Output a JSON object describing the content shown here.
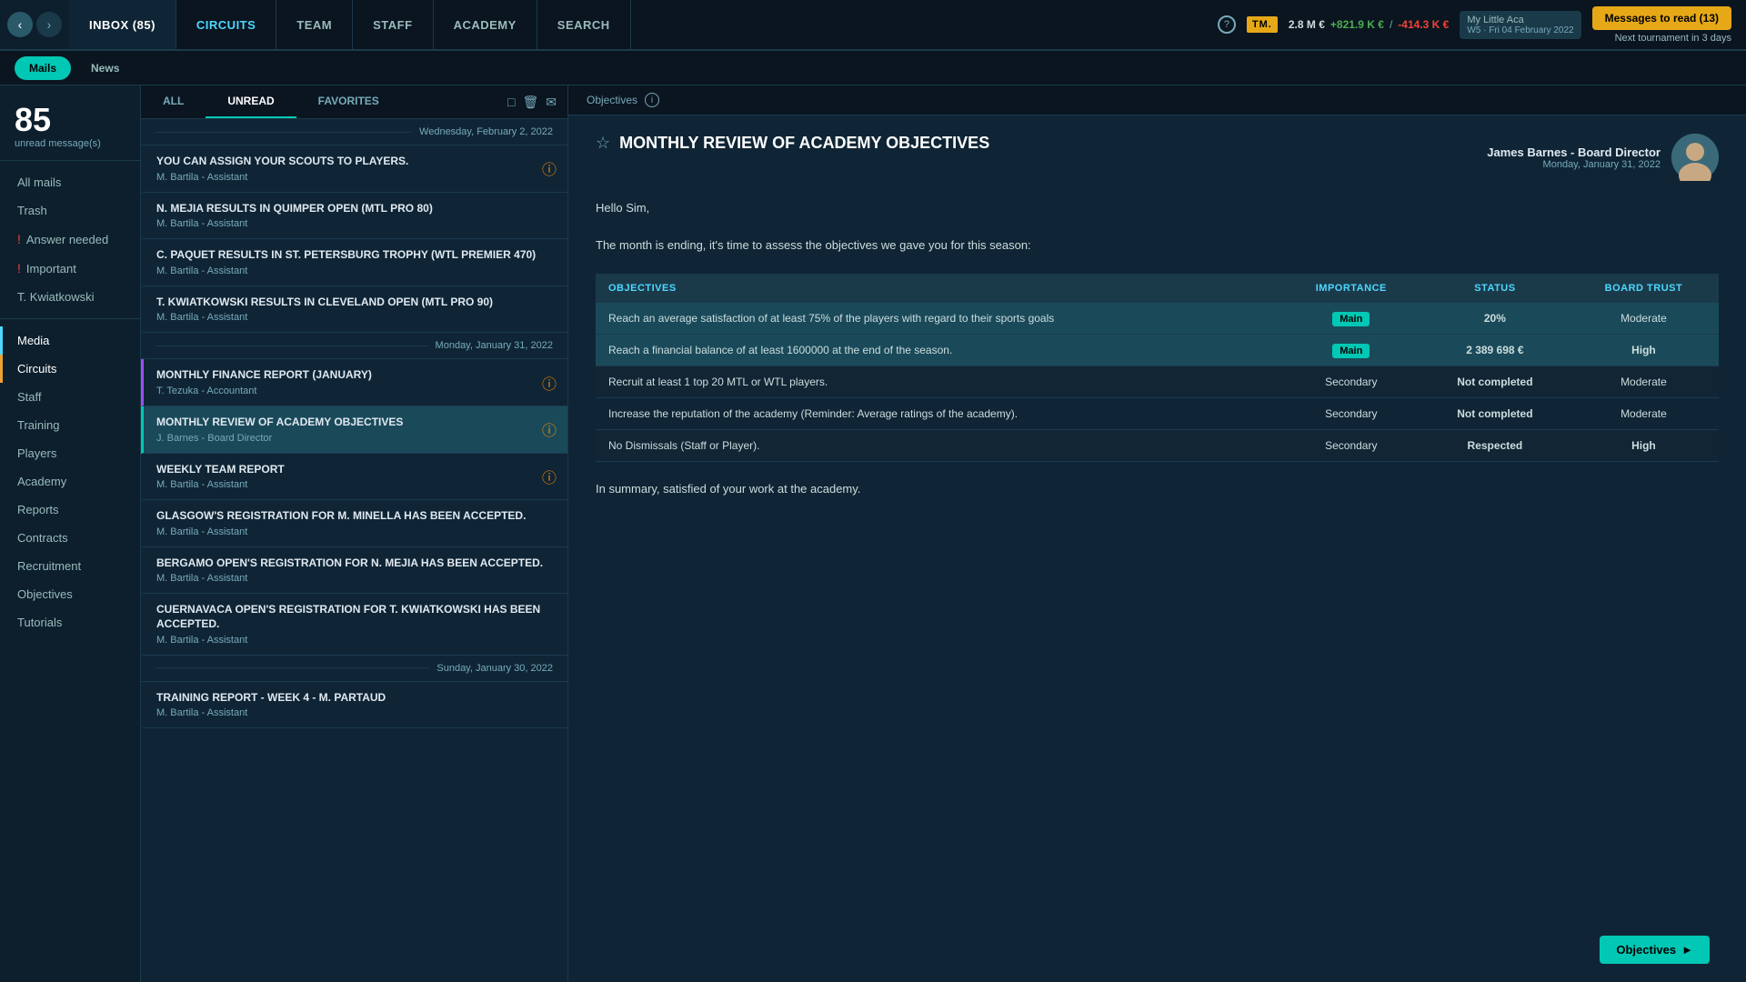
{
  "topnav": {
    "items": [
      {
        "id": "inbox",
        "label": "INBOX (85)",
        "active": true
      },
      {
        "id": "circuits",
        "label": "CIRCUITS",
        "active": false,
        "highlight": true
      },
      {
        "id": "team",
        "label": "TEAM",
        "active": false
      },
      {
        "id": "staff",
        "label": "STAFF",
        "active": false
      },
      {
        "id": "academy",
        "label": "ACADEMY",
        "active": false
      },
      {
        "id": "search",
        "label": "SEARCH",
        "active": false
      }
    ],
    "finance": {
      "balance": "2.8 M €",
      "income": "+821.9 K €",
      "expense": "-414.3 K €"
    },
    "club": {
      "name": "My Little Aca",
      "week": "W5 · Fri 04 February 2022"
    },
    "messages_btn": "Messages to read (13)",
    "tournament": "Next tournament in 3 days"
  },
  "subnav": {
    "mails_label": "Mails",
    "news_label": "News"
  },
  "sidebar": {
    "inbox_count": "85",
    "inbox_sublabel": "unread message(s)",
    "items": [
      {
        "id": "all-mails",
        "label": "All mails",
        "active": false
      },
      {
        "id": "trash",
        "label": "Trash",
        "active": false
      },
      {
        "id": "answer-needed",
        "label": "Answer needed",
        "active": false,
        "badge": "!"
      },
      {
        "id": "important",
        "label": "Important",
        "active": false,
        "badge": "!"
      },
      {
        "id": "t-kwiatkowski",
        "label": "T. Kwiatkowski",
        "active": false
      },
      {
        "id": "media",
        "label": "Media",
        "active": false,
        "color": "media"
      },
      {
        "id": "circuits",
        "label": "Circuits",
        "active": false,
        "color": "circuits-s"
      },
      {
        "id": "staff",
        "label": "Staff",
        "active": false
      },
      {
        "id": "training",
        "label": "Training",
        "active": false
      },
      {
        "id": "players",
        "label": "Players",
        "active": false
      },
      {
        "id": "academy",
        "label": "Academy",
        "active": false
      },
      {
        "id": "reports",
        "label": "Reports",
        "active": false
      },
      {
        "id": "contracts",
        "label": "Contracts",
        "active": false
      },
      {
        "id": "recruitment",
        "label": "Recruitment",
        "active": false
      },
      {
        "id": "objectives",
        "label": "Objectives",
        "active": false
      },
      {
        "id": "tutorials",
        "label": "Tutorials",
        "active": false
      }
    ]
  },
  "msglist": {
    "tabs": [
      {
        "id": "all",
        "label": "ALL"
      },
      {
        "id": "unread",
        "label": "UNREAD",
        "active": true
      },
      {
        "id": "favorites",
        "label": "FAVORITES"
      }
    ],
    "date_groups": [
      {
        "date": "Wednesday, February 2, 2022",
        "messages": [
          {
            "id": "msg1",
            "title": "YOU CAN ASSIGN YOUR SCOUTS TO PLAYERS.",
            "sender": "M. Bartila - Assistant",
            "alert": true
          },
          {
            "id": "msg2",
            "title": "N. MEJIA RESULTS IN QUIMPER OPEN (MTL PRO 80)",
            "sender": "M. Bartila - Assistant",
            "alert": false
          },
          {
            "id": "msg3",
            "title": "C. PAQUET RESULTS IN ST. PETERSBURG TROPHY (WTL PREMIER 470)",
            "sender": "M. Bartila - Assistant",
            "alert": false
          },
          {
            "id": "msg4",
            "title": "T. KWIATKOWSKI RESULTS IN CLEVELAND OPEN (MTL PRO 90)",
            "sender": "M. Bartila - Assistant",
            "alert": false
          }
        ]
      },
      {
        "date": "Monday, January 31, 2022",
        "messages": [
          {
            "id": "msg5",
            "title": "MONTHLY FINANCE REPORT (JANUARY)",
            "sender": "T. Tezuka - Accountant",
            "alert": true,
            "unread_highlight": true
          },
          {
            "id": "msg6",
            "title": "MONTHLY REVIEW OF ACADEMY OBJECTIVES",
            "sender": "J. Barnes - Board Director",
            "alert": true,
            "active": true
          },
          {
            "id": "msg7",
            "title": "WEEKLY TEAM REPORT",
            "sender": "M. Bartila - Assistant",
            "alert": true
          },
          {
            "id": "msg8",
            "title": "GLASGOW'S REGISTRATION FOR M. MINELLA HAS BEEN ACCEPTED.",
            "sender": "M. Bartila - Assistant",
            "alert": false
          },
          {
            "id": "msg9",
            "title": "BERGAMO OPEN'S REGISTRATION FOR N. MEJIA HAS BEEN ACCEPTED.",
            "sender": "M. Bartila - Assistant",
            "alert": false
          },
          {
            "id": "msg10",
            "title": "CUERNAVACA OPEN'S REGISTRATION FOR T. KWIATKOWSKI HAS BEEN ACCEPTED.",
            "sender": "M. Bartila - Assistant",
            "alert": false
          }
        ]
      },
      {
        "date": "Sunday, January 30, 2022",
        "messages": [
          {
            "id": "msg11",
            "title": "TRAINING REPORT - WEEK 4 - M. PARTAUD",
            "sender": "M. Bartila - Assistant",
            "alert": false
          }
        ]
      }
    ]
  },
  "email": {
    "category_label": "Objectives",
    "subject": "MONTHLY REVIEW OF ACADEMY OBJECTIVES",
    "sender_name": "James Barnes - Board Director",
    "sender_date": "Monday, January 31, 2022",
    "greeting": "Hello Sim,",
    "body": "The month is ending, it's time to assess the objectives we gave you for this season:",
    "table_headers": {
      "objectives": "OBJECTIVES",
      "importance": "IMPORTANCE",
      "status": "STATUS",
      "board_trust": "BOARD TRUST"
    },
    "objectives": [
      {
        "id": "obj1",
        "text": "Reach an average satisfaction of at least 75% of the players with regard to their sports goals",
        "importance": "Main",
        "status": "20%",
        "status_type": "pct",
        "board_trust": "Moderate",
        "trust_type": "moderate",
        "highlighted": true
      },
      {
        "id": "obj2",
        "text": "Reach a financial balance of at least 1600000 at the end of the season.",
        "importance": "Main",
        "status": "2 389 698 €",
        "status_type": "green",
        "board_trust": "High",
        "trust_type": "high",
        "highlighted": true
      },
      {
        "id": "obj3",
        "text": "Recruit at least 1 top 20 MTL or WTL players.",
        "importance": "Secondary",
        "status": "Not completed",
        "status_type": "red",
        "board_trust": "Moderate",
        "trust_type": "moderate",
        "highlighted": false
      },
      {
        "id": "obj4",
        "text": "Increase the reputation of the academy (Reminder: Average ratings of the academy).",
        "importance": "Secondary",
        "status": "Not completed",
        "status_type": "red",
        "board_trust": "Moderate",
        "trust_type": "moderate",
        "highlighted": false
      },
      {
        "id": "obj5",
        "text": "No Dismissals (Staff or Player).",
        "importance": "Secondary",
        "status": "Respected",
        "status_type": "respected",
        "board_trust": "High",
        "trust_type": "high",
        "highlighted": false
      }
    ],
    "summary": "In summary, satisfied of your work at the academy."
  },
  "objectives_btn": "Objectives"
}
